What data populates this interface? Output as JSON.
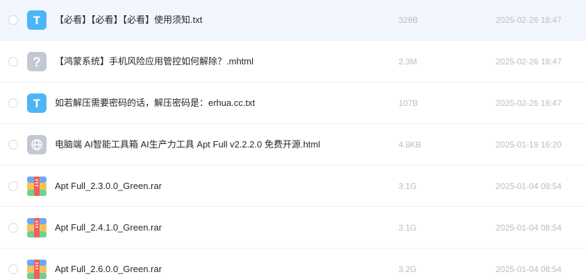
{
  "files": [
    {
      "name": "【必看】【必看】【必看】使用须知.txt",
      "size": "329B",
      "date": "2025-02-26 18:47",
      "icon": "txt-file-icon",
      "icon_letter": "T"
    },
    {
      "name": "【鸿蒙系统】手机风险应用管控如何解除？.mhtml",
      "size": "2.3M",
      "date": "2025-02-26 18:47",
      "icon": "unknown-file-icon",
      "icon_letter": "?"
    },
    {
      "name": "如若解压需要密码的话，解压密码是：erhua.cc.txt",
      "size": "107B",
      "date": "2025-02-26 18:47",
      "icon": "txt-file-icon",
      "icon_letter": "T"
    },
    {
      "name": "电脑端 AI智能工具箱 AI生产力工具 Apt Full v2.2.2.0 免费开源.html",
      "size": "4.8KB",
      "date": "2025-01-19 16:20",
      "icon": "web-file-icon"
    },
    {
      "name": "Apt Full_2.3.0.0_Green.rar",
      "size": "3.1G",
      "date": "2025-01-04 08:54",
      "icon": "archive-file-icon"
    },
    {
      "name": "Apt Full_2.4.1.0_Green.rar",
      "size": "3.1G",
      "date": "2025-01-04 08:54",
      "icon": "archive-file-icon"
    },
    {
      "name": "Apt Full_2.6.0.0_Green.rar",
      "size": "3.2G",
      "date": "2025-01-04 08:54",
      "icon": "archive-file-icon"
    }
  ],
  "colors": {
    "hover_row": "#f2f6ff",
    "txt_icon": "#4cb5f5",
    "unknown_icon": "#c3c8d3",
    "web_icon": "#c3c8d3",
    "archive_blue": "#6fa8f2",
    "archive_yellow": "#f7c15c",
    "archive_green": "#6fd18f",
    "archive_red": "#f0605d"
  }
}
